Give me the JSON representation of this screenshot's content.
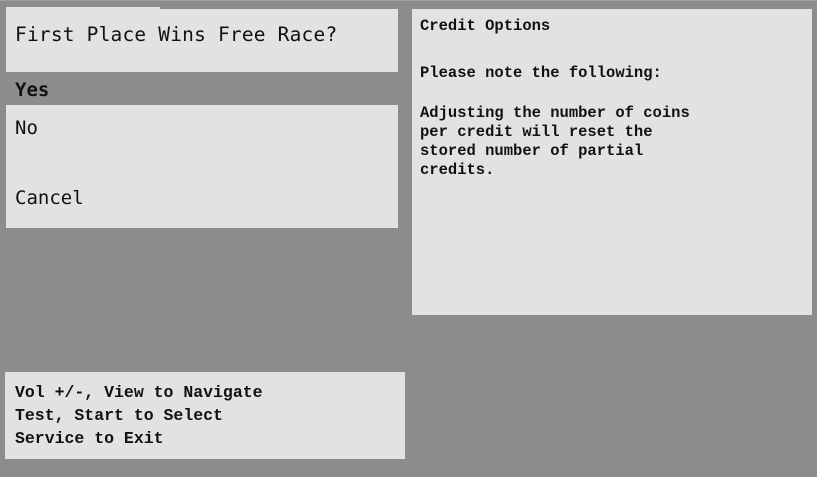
{
  "menu": {
    "title": "First Place Wins Free Race?",
    "options": [
      {
        "label": "Yes",
        "selected": true
      },
      {
        "label": "No",
        "selected": false
      },
      {
        "label": "Cancel",
        "selected": false
      }
    ]
  },
  "info": {
    "title": "Credit Options",
    "note": "Please note the following:",
    "body_lines": [
      "Adjusting the number of coins",
      "per credit will reset the",
      "stored number of partial",
      "credits."
    ]
  },
  "help": {
    "lines": [
      "Vol +/-, View to Navigate",
      "Test, Start to Select",
      "Service to Exit"
    ]
  },
  "colors": {
    "background": "#8c8c8c",
    "panel": "#e2e2e2",
    "selected_row": "#8d8d8d",
    "text": "#111111"
  }
}
